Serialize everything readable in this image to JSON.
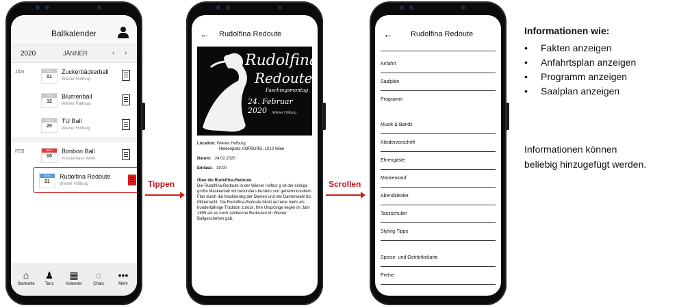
{
  "phone1": {
    "title": "Ballkalender",
    "year": "2020",
    "month": "JÄNNER",
    "prev": "‹",
    "next": "›",
    "groups": [
      {
        "month": "JÄN",
        "events": [
          {
            "dow": "SAT",
            "day": "01",
            "name": "Zuckerbäckerball",
            "location": "Wiener Hofburg"
          },
          {
            "dow": "THU",
            "day": "12",
            "name": "Blumenball",
            "location": "Wiener Rathaus"
          },
          {
            "dow": "WED",
            "day": "20",
            "name": "TU Ball",
            "location": "Wiener Hofburg"
          }
        ]
      },
      {
        "month": "FEB",
        "events": [
          {
            "dow": "WED",
            "day": "08",
            "name": "Bonbon Ball",
            "location": "Konzerthaus Wien"
          },
          {
            "dow": "MON",
            "day": "21",
            "name": "Rudolfina Redoute",
            "location": "Wiener Hofburg"
          }
        ]
      }
    ],
    "tabs": [
      "Startseite",
      "Tanz",
      "Kalender",
      "Chats",
      "Mehr"
    ]
  },
  "phone2": {
    "back": "←",
    "title": "Rudolfina Redoute",
    "poster": {
      "small": "The",
      "line1": "Rudolfina",
      "line2": "Redoute",
      "sub": "Faschingsmontag",
      "date": "24. Februar 2020",
      "place": "Wiener Hofburg"
    },
    "location_label": "Location:",
    "location_value": "Wiener Hofburg",
    "location_address": "Heldenplatz HOFBURG, 1010 Wien",
    "date_label": "Datum:",
    "date_value": "24.02.2020",
    "entry_label": "Einlass:",
    "entry_value": "19:00",
    "about_title": "Über die Rudolfina-Redoute",
    "about_text": "Die Rudolfina-Redoute in der Wiener Hofbur g ist der einzige große Maskenball mit besonders buntem und geheimnisvollem Flair durch die Maskierung der Damen und der Damenwahl bis Mitternacht. Die Rudolfina-Redoute blickt auf eine mehr als hundertjährige Tradition zurück. Ihre Ursprünge liegen im Jahr 1899 als es noch zahlreiche Redouten im Wiener Ballgeschehen gab."
  },
  "phone3": {
    "back": "←",
    "title": "Rudolfina Redoute",
    "items1": [
      "Anfahrt",
      "Saalplan",
      "Programm"
    ],
    "items2": [
      "Musik & Bands",
      "Kleidervorschrift",
      "Ehrengäste",
      "Maskenkauf",
      "Abendkleider",
      "Tanzschulen",
      "Styling-Tipps"
    ],
    "items3": [
      "Speise- und Getränkekarte",
      "Preise"
    ]
  },
  "arrows": {
    "tap": "Tippen",
    "scroll": "Scrollen"
  },
  "side": {
    "title": "Informationen wie:",
    "bullets": [
      "Fakten anzeigen",
      "Anfahrtsplan anzeigen",
      "Programm anzeigen",
      "Saalplan anzeigen"
    ],
    "note_line1": "Informationen können",
    "note_line2": "beliebig hinzugefügt werden."
  },
  "colors": {
    "accent": "#d41c1c",
    "label": "#c0141a"
  }
}
